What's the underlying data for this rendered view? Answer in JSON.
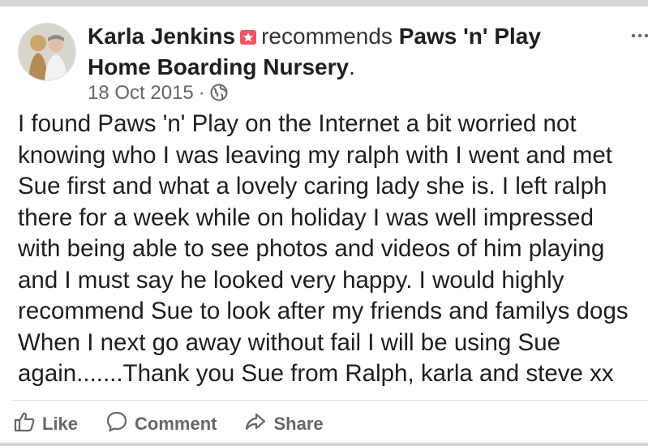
{
  "post": {
    "author": "Karla Jenkins",
    "action_text": "recommends",
    "page_name": "Paws 'n' Play Home Boarding Nursery",
    "period": ".",
    "date": "18 Oct 2015",
    "separator": "·",
    "audience_icon": "globe-icon",
    "more_icon": "more-options-icon",
    "recommend_icon": "recommend-flag-icon",
    "body_lines": [
      "I found Paws 'n' Play on the Internet a bit worried not",
      "knowing who I was leaving my ralph with I went and met",
      "Sue first and what a lovely caring lady she is. I left ralph",
      "there for a week while on holiday I was well impressed",
      "with being able to see photos and videos of him playing",
      "and I must say he looked very happy. I would highly",
      "recommend Sue to look after my friends and familys dogs",
      "When I next go away without fail I will be using Sue",
      "again.......Thank you Sue from Ralph, karla and steve xx"
    ]
  },
  "actions": {
    "like_label": "Like",
    "comment_label": "Comment",
    "share_label": "Share"
  },
  "colors": {
    "text": "#1c1e21",
    "secondary": "#65676b",
    "recommend_badge": "#f35369",
    "divider": "#dadde1"
  }
}
